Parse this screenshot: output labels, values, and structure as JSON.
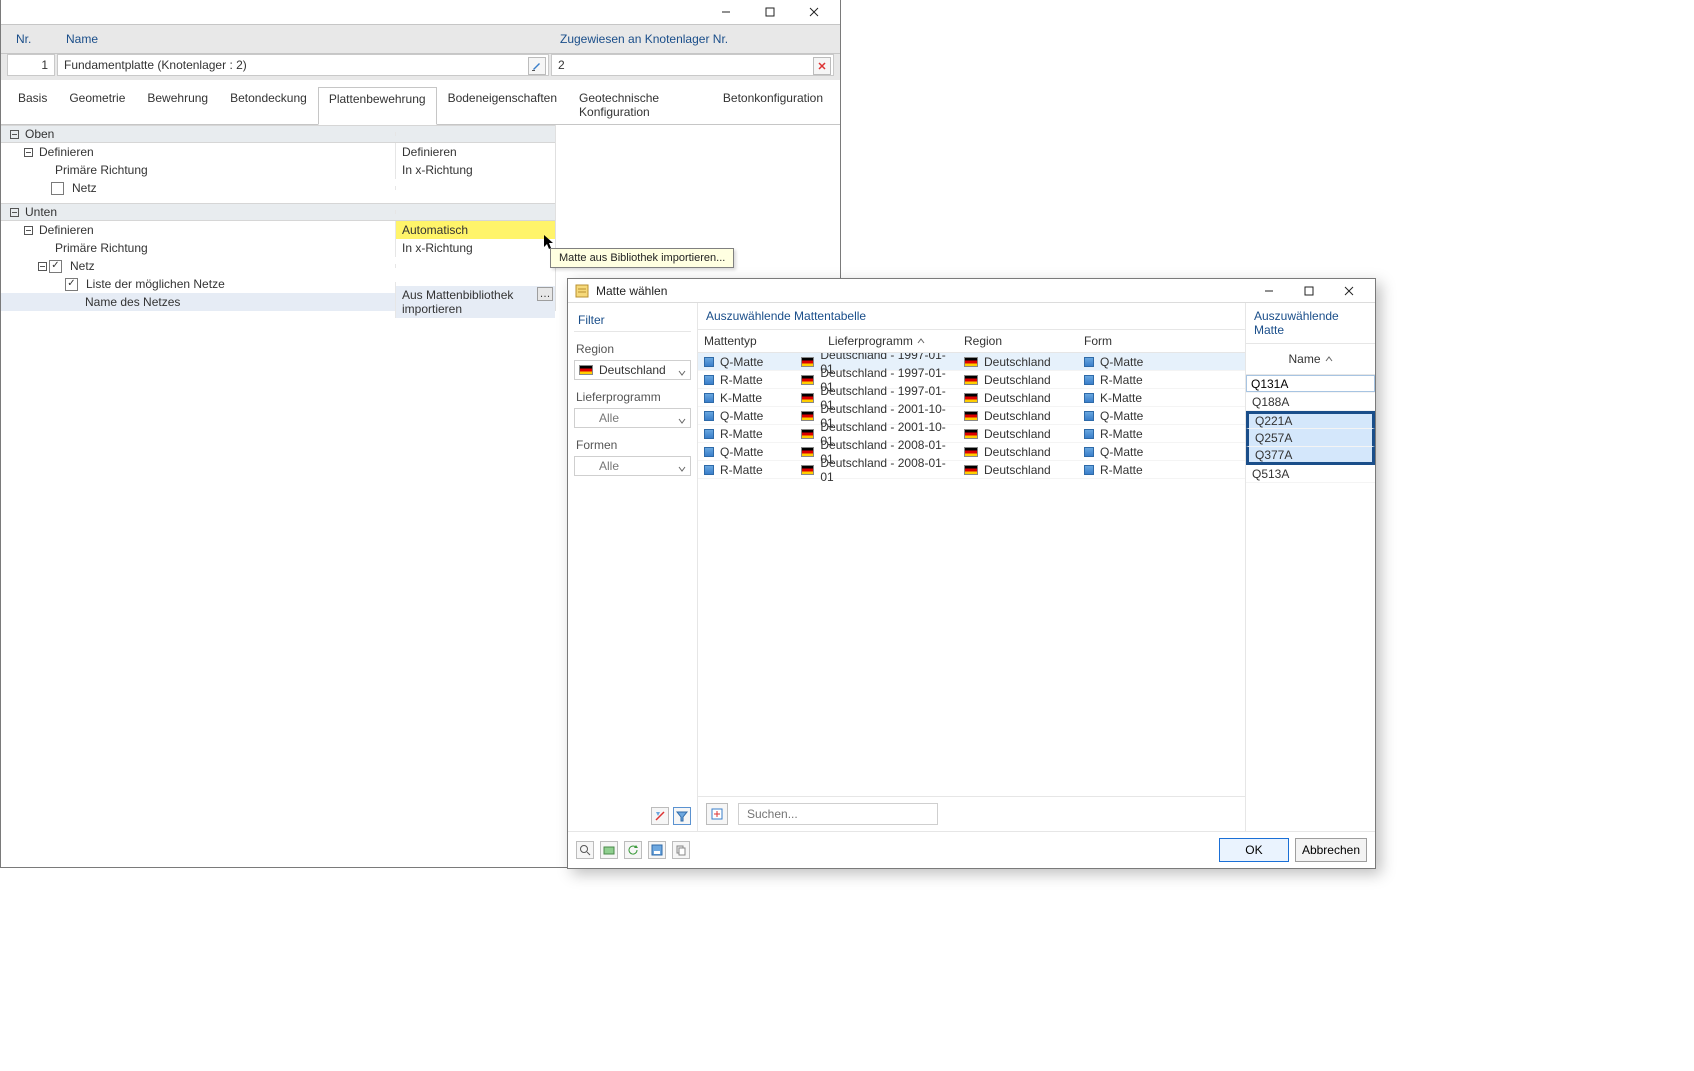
{
  "main": {
    "header": {
      "nr": "Nr.",
      "name": "Name",
      "assigned": "Zugewiesen an Knotenlager Nr."
    },
    "values": {
      "nr": "1",
      "name": "Fundamentplatte (Knotenlager : 2)",
      "assigned": "2"
    },
    "tabs": [
      "Basis",
      "Geometrie",
      "Bewehrung",
      "Betondeckung",
      "Plattenbewehrung",
      "Bodeneigenschaften",
      "Geotechnische Konfiguration",
      "Betonkonfiguration"
    ],
    "active_tab_index": 4,
    "top": {
      "section": "Oben",
      "define_label": "Definieren",
      "define_value": "Definieren",
      "dir_label": "Primäre Richtung",
      "dir_value": "In x-Richtung",
      "netz_label": "Netz"
    },
    "bottom": {
      "section": "Unten",
      "define_label": "Definieren",
      "define_value": "Automatisch",
      "dir_label": "Primäre Richtung",
      "dir_value": "In x-Richtung",
      "netz_label": "Netz",
      "list_label": "Liste der möglichen Netze",
      "namerow_label": "Name des Netzes",
      "namerow_value": "Aus Mattenbibliothek importieren"
    },
    "tooltip": "Matte aus Bibliothek importieren..."
  },
  "dialog": {
    "title": "Matte wählen",
    "filter": {
      "heading": "Filter",
      "region_label": "Region",
      "region_value": "Deutschland",
      "program_label": "Lieferprogramm",
      "program_value": "Alle",
      "form_label": "Formen",
      "form_value": "Alle"
    },
    "table": {
      "heading": "Auszuwählende Mattentabelle",
      "cols": {
        "type": "Mattentyp",
        "program": "Lieferprogramm",
        "region": "Region",
        "form": "Form"
      },
      "rows": [
        {
          "type": "Q-Matte",
          "program": "Deutschland - 1997-01-01",
          "region": "Deutschland",
          "form": "Q-Matte",
          "selected": true
        },
        {
          "type": "R-Matte",
          "program": "Deutschland - 1997-01-01",
          "region": "Deutschland",
          "form": "R-Matte"
        },
        {
          "type": "K-Matte",
          "program": "Deutschland - 1997-01-01",
          "region": "Deutschland",
          "form": "K-Matte"
        },
        {
          "type": "Q-Matte",
          "program": "Deutschland - 2001-10-01",
          "region": "Deutschland",
          "form": "Q-Matte"
        },
        {
          "type": "R-Matte",
          "program": "Deutschland - 2001-10-01",
          "region": "Deutschland",
          "form": "R-Matte"
        },
        {
          "type": "Q-Matte",
          "program": "Deutschland - 2008-01-01",
          "region": "Deutschland",
          "form": "Q-Matte"
        },
        {
          "type": "R-Matte",
          "program": "Deutschland - 2008-01-01",
          "region": "Deutschland",
          "form": "R-Matte"
        }
      ]
    },
    "names": {
      "heading": "Auszuwählende Matte",
      "col": "Name",
      "input_value": "Q131A",
      "rows": [
        {
          "v": "Q188A"
        },
        {
          "v": "Q221A",
          "sel": "top"
        },
        {
          "v": "Q257A",
          "sel": "mid"
        },
        {
          "v": "Q377A",
          "sel": "bot"
        },
        {
          "v": "Q513A"
        }
      ]
    },
    "search_placeholder": "Suchen...",
    "ok": "OK",
    "cancel": "Abbrechen"
  }
}
